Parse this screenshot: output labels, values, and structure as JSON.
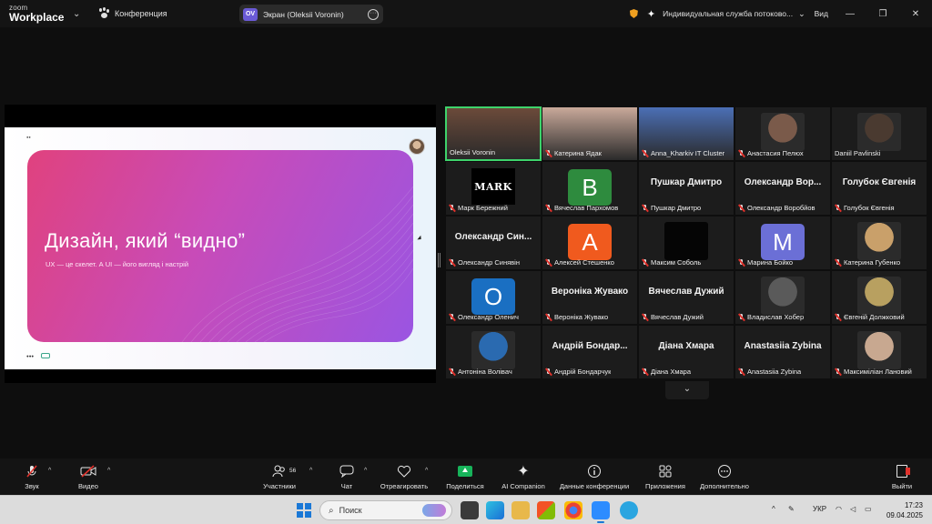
{
  "titlebar": {
    "brand_line1": "zoom",
    "brand_line2": "Workplace",
    "meeting_label": "Конференция",
    "share_pill": {
      "initials": "OV",
      "label": "Экран (Oleksii Voronin)"
    },
    "service_label": "Индивидуальная служба потоково...",
    "view_label": "Вид",
    "icons": [
      "chevron-down-icon",
      "paw-icon",
      "more-icon",
      "shield-icon",
      "sparkle-icon",
      "minimize-icon",
      "restore-icon",
      "close-icon"
    ]
  },
  "slide": {
    "title": "Дизайн, який “видно”",
    "subtitle": "UX — це скелет. А UI — його вигляд і настрій",
    "colors": {
      "start": "#e0427e",
      "end": "#9a55e2"
    }
  },
  "gallery": {
    "tiles": [
      {
        "name": "Oleksii Voronin",
        "kind": "photo",
        "active": true,
        "muted": false,
        "color": "#6b4a3a"
      },
      {
        "name": "Катерина Ядак",
        "kind": "photo",
        "muted": true,
        "color": "#c9a99a"
      },
      {
        "name": "Anna_Kharkiv IT Cluster",
        "kind": "photo",
        "muted": true,
        "color": "#4b6fb5"
      },
      {
        "name": "Анастасия Пелюх",
        "kind": "avatar",
        "muted": true,
        "color": "#7a5a4a"
      },
      {
        "name": "Daniil Pavlinski",
        "kind": "avatar",
        "muted": false,
        "color": "#4a3a30"
      },
      {
        "name": "Марк Бережний",
        "kind": "mark",
        "avatar_text": "MARK",
        "muted": true
      },
      {
        "name": "Вячеслав Пархомов",
        "kind": "letter",
        "letter": "B",
        "muted": true,
        "color": "#2e8b3e"
      },
      {
        "name": "Пушкар Дмитро",
        "kind": "text",
        "big": "Пушкар Дмитро",
        "muted": true
      },
      {
        "name": "Олександр Воробйов",
        "kind": "text",
        "big": "Олександр Вор...",
        "muted": true
      },
      {
        "name": "Голубок Євгенія",
        "kind": "text",
        "big": "Голубок Євгенія",
        "muted": true
      },
      {
        "name": "Олександр Синявін",
        "kind": "text",
        "big": "Олександр Син...",
        "muted": true
      },
      {
        "name": "Алексей Стешенко",
        "kind": "letter",
        "letter": "A",
        "muted": true,
        "color": "#f05a1e"
      },
      {
        "name": "Максим Соболь",
        "kind": "blank",
        "muted": true,
        "color": "#050505"
      },
      {
        "name": "Марина Бойко",
        "kind": "letter",
        "letter": "M",
        "muted": true,
        "color": "#6b6fd6"
      },
      {
        "name": "Катерина Губенко",
        "kind": "avatar",
        "muted": true,
        "color": "#c9a06a"
      },
      {
        "name": "Олександр Оленич",
        "kind": "letter",
        "letter": "O",
        "muted": true,
        "color": "#1a6fc2"
      },
      {
        "name": "Вероніка Жувако",
        "kind": "text",
        "big": "Вероніка Жувако",
        "muted": true
      },
      {
        "name": "Вячеслав Дужий",
        "kind": "text",
        "big": "Вячеслав Дужий",
        "muted": true
      },
      {
        "name": "Владислав Хобер",
        "kind": "avatar",
        "muted": true,
        "color": "#5a5a5a"
      },
      {
        "name": "Євгеній Должковий",
        "kind": "avatar",
        "muted": true,
        "color": "#b8a060"
      },
      {
        "name": "Антоніна Волівач",
        "kind": "avatar",
        "muted": true,
        "color": "#2a6ab0"
      },
      {
        "name": "Андрій Бондарчук",
        "kind": "text",
        "big": "Андрій Бондар...",
        "muted": true
      },
      {
        "name": "Діана Хмара",
        "kind": "text",
        "big": "Діана Хмара",
        "muted": true
      },
      {
        "name": "Anastasiia Zybina",
        "kind": "text",
        "big": "Anastasiia Zybina",
        "muted": true
      },
      {
        "name": "Максиміліан Лановий",
        "kind": "avatar",
        "muted": true,
        "color": "#c8a890"
      }
    ]
  },
  "controls": {
    "audio": "Звук",
    "video": "Видео",
    "participants": "Участники",
    "participants_count": "56",
    "chat": "Чат",
    "react": "Отреагировать",
    "share": "Поделиться",
    "ai": "AI Companion",
    "meeting_info": "Данные конференции",
    "apps": "Приложения",
    "more": "Дополнительно",
    "leave": "Выйти"
  },
  "taskbar": {
    "search_placeholder": "Поиск",
    "lang": "УКР",
    "time": "17:23",
    "date": "09.04.2025",
    "accent": "#1a78d6"
  }
}
